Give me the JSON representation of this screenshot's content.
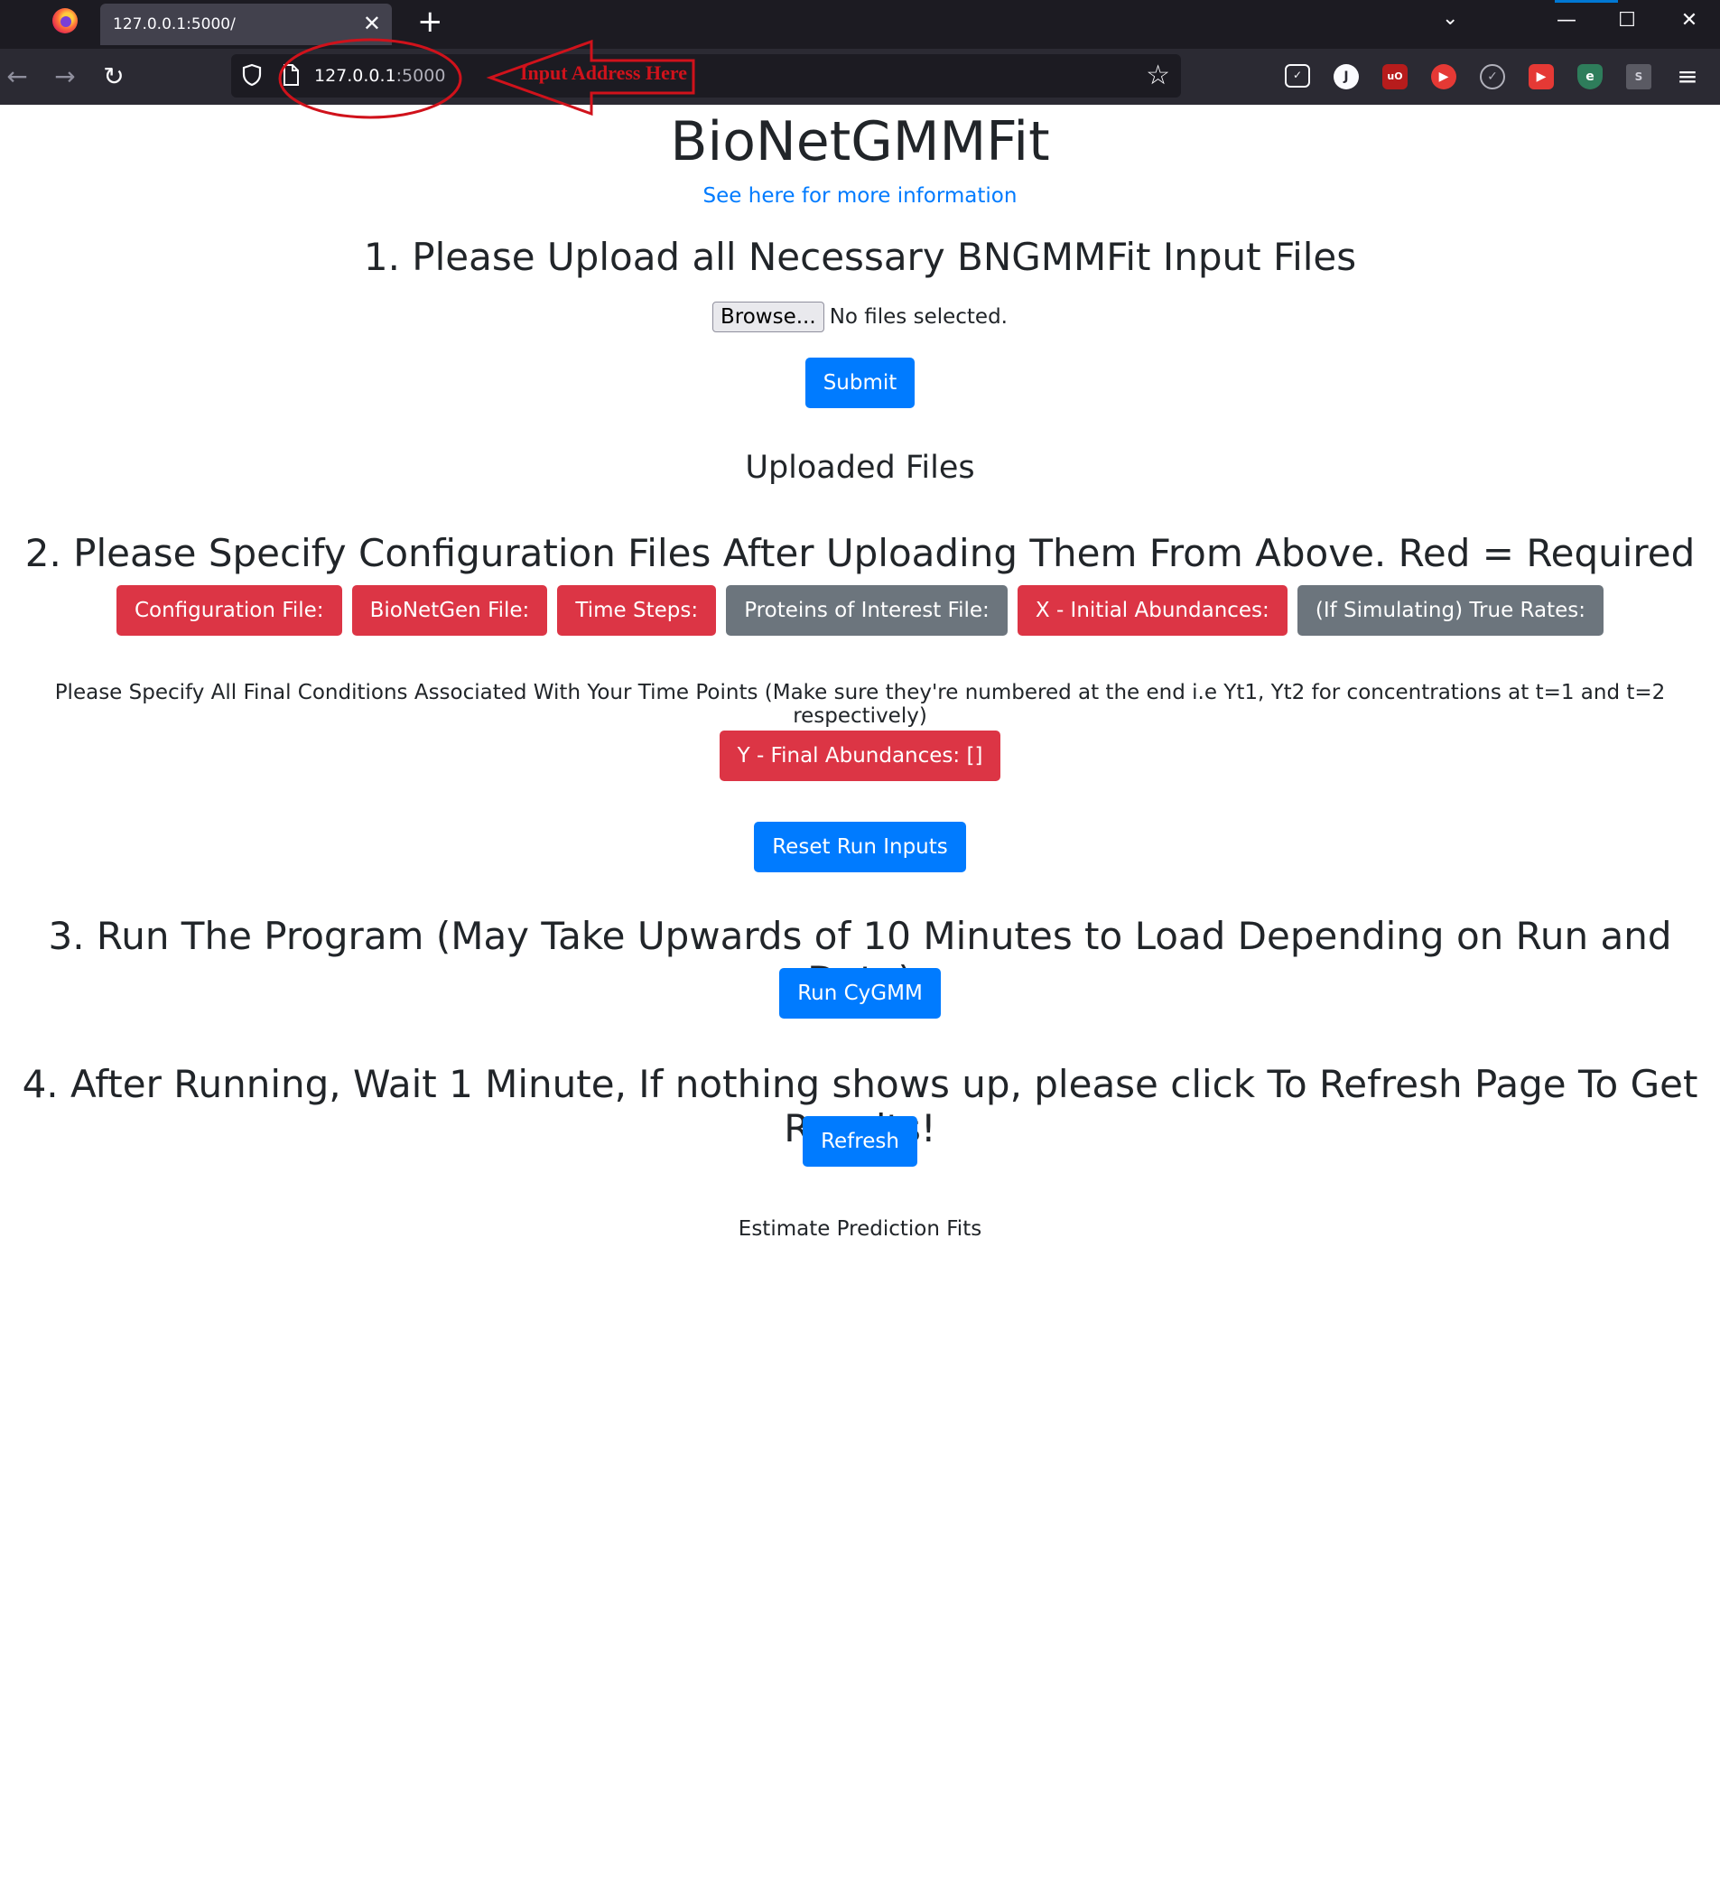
{
  "browser": {
    "tab_title": "127.0.0.1:5000/",
    "url_host": "127.0.0.1",
    "url_port": ":5000",
    "annotation": "Input Address Here",
    "annotation_color": "#d0121b"
  },
  "page": {
    "title": "BioNetGMMFit",
    "info_link": "See here for more information",
    "step1": {
      "heading": "1. Please Upload all Necessary BNGMMFit Input Files",
      "browse_label": "Browse...",
      "file_status": "No files selected.",
      "submit_label": "Submit",
      "uploaded_heading": "Uploaded Files"
    },
    "step2": {
      "heading": "2. Please Specify Configuration Files After Uploading Them From Above. Red = Required",
      "file_buttons": [
        {
          "label": "Configuration File:",
          "required": true
        },
        {
          "label": "BioNetGen File:",
          "required": true
        },
        {
          "label": "Time Steps:",
          "required": true
        },
        {
          "label": "Proteins of Interest File:",
          "required": false
        },
        {
          "label": "X - Initial Abundances:",
          "required": true
        },
        {
          "label": "(If Simulating) True Rates:",
          "required": false
        }
      ],
      "final_note": "Please Specify All Final Conditions Associated With Your Time Points (Make sure they're numbered at the end i.e Yt1, Yt2 for concentrations at t=1 and t=2 respectively)",
      "final_button": "Y - Final Abundances: []",
      "reset_label": "Reset Run Inputs"
    },
    "step3": {
      "heading": "3. Run The Program (May Take Upwards of 10 Minutes to Load Depending on Run and Data)",
      "run_label": "Run CyGMM"
    },
    "step4": {
      "heading": "4. After Running, Wait 1 Minute, If nothing shows up, please click To Refresh Page To Get Results!",
      "refresh_label": "Refresh"
    },
    "estimate_label": "Estimate Prediction Fits"
  },
  "colors": {
    "primary": "#007bff",
    "required": "#dc3545",
    "optional": "#6c757d"
  }
}
